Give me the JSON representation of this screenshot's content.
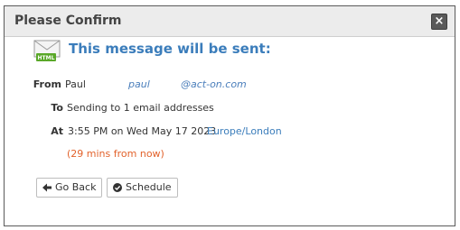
{
  "dialog": {
    "title": "Please Confirm",
    "close_icon": "close-icon",
    "heading": "This message will be sent:"
  },
  "details": {
    "from_label": "From",
    "from_name": "Paul",
    "from_user": "paul",
    "from_domain": "@act-on.com",
    "to_label": "To",
    "to_value": "Sending to 1 email addresses",
    "at_label": "At",
    "at_value": "3:55 PM on Wed May 17 2023",
    "timezone": "Europe/London",
    "relative": "(29 mins from now)"
  },
  "buttons": {
    "back_label": "Go Back",
    "schedule_label": "Schedule"
  },
  "colors": {
    "accent": "#3b7dbb",
    "warning": "#e2622b",
    "html_badge": "#5aa829"
  }
}
